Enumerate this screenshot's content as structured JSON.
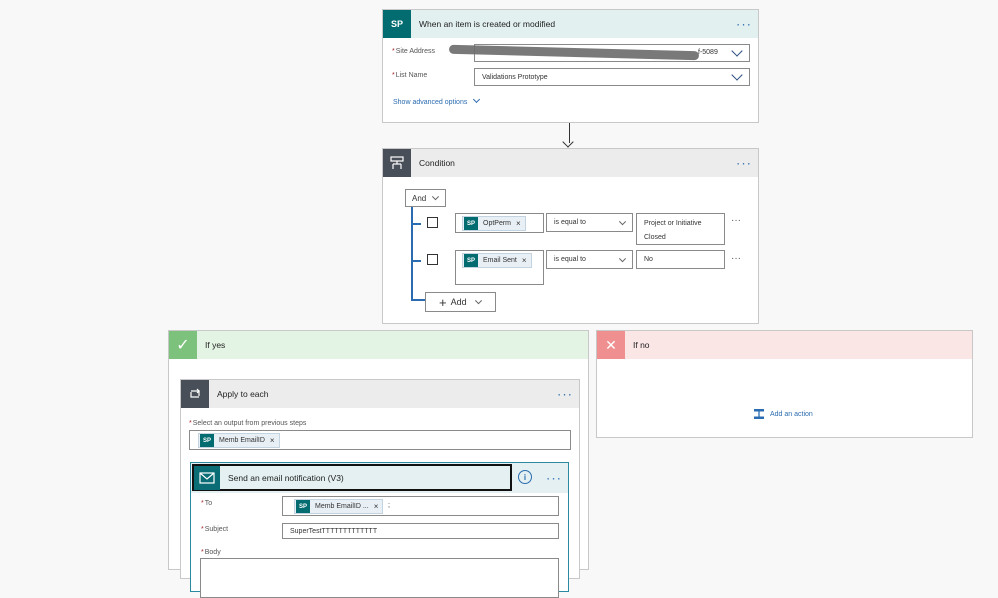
{
  "trigger": {
    "title": "When an item is created or modified",
    "site_address_label": "Site Address",
    "site_address_value": "f-5089",
    "list_name_label": "List Name",
    "list_name_value": "Validations Prototype",
    "advanced_options": "Show advanced options"
  },
  "condition": {
    "title": "Condition",
    "group_operator": "And",
    "rows": [
      {
        "token": "OptPerm",
        "operator": "is equal to",
        "value": "Project or Initiative Closed"
      },
      {
        "token": "Email Sent",
        "operator": "is equal to",
        "value": "No"
      }
    ],
    "add_label": "Add"
  },
  "if_yes": {
    "title": "If yes",
    "apply_each": {
      "title": "Apply to each",
      "select_label": "Select an output from previous steps",
      "token": "Memb EmailID"
    },
    "email": {
      "title": "Send an email notification (V3)",
      "to_label": "To",
      "to_token": "Memb EmailID ...",
      "to_suffix": ";",
      "subject_label": "Subject",
      "subject_value": "SuperTestTTTTTTTTTTTTT",
      "body_label": "Body"
    }
  },
  "if_no": {
    "title": "If no",
    "add_action": "Add an action"
  },
  "icons": {
    "sharepoint": "SP",
    "ellipsis": "···",
    "close": "×",
    "check": "✓",
    "cross": "✕"
  },
  "colors": {
    "sharepoint_teal": "#036c70",
    "condition_gray": "#484f58",
    "yes_green": "#5cb85c",
    "no_red": "#e87070",
    "link_blue": "#2b6cb0",
    "mail_teal": "#0a6c74"
  }
}
